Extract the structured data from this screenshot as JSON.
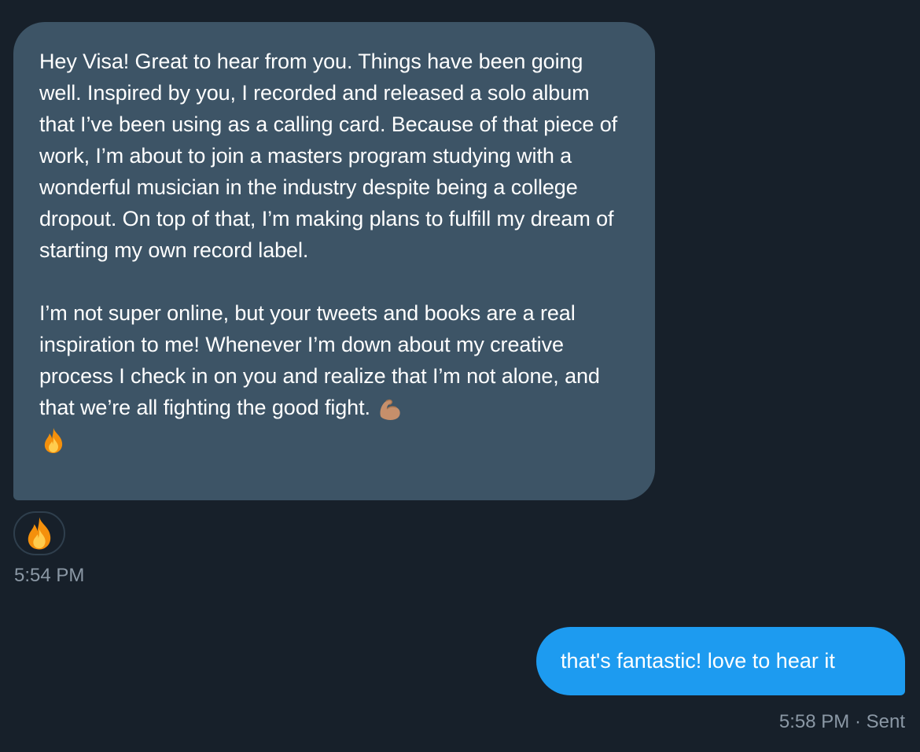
{
  "conversation": {
    "incoming_message": {
      "paragraph_1": "Hey Visa! Great to hear from you. Things have been going well. Inspired by you, I recorded and released a solo album that I’ve been using as a calling card. Because of that piece of work, I’m about to join a masters program studying with a wonderful musician in the industry despite being a college dropout. On top of that, I’m making plans to fulfill my dream of starting my own record label.",
      "paragraph_2": "I’m not super online, but your tweets and books are a real inspiration to me! Whenever I’m down about my creative process I check in on you and realize that I’m not alone, and that we’re all fighting the good fight.",
      "trailing_emojis": [
        "flexed-biceps-icon",
        "fire-icon"
      ],
      "reaction_emoji": "fire-icon",
      "timestamp": "5:54 PM"
    },
    "outgoing_message": {
      "text": "that's fantastic! love to hear it",
      "timestamp": "5:58 PM",
      "separator": "·",
      "status": "Sent"
    }
  },
  "colors": {
    "background": "#17202a",
    "incoming_bubble": "#3d5466",
    "outgoing_bubble": "#1d9bf0",
    "meta_text": "#8b98a5"
  }
}
